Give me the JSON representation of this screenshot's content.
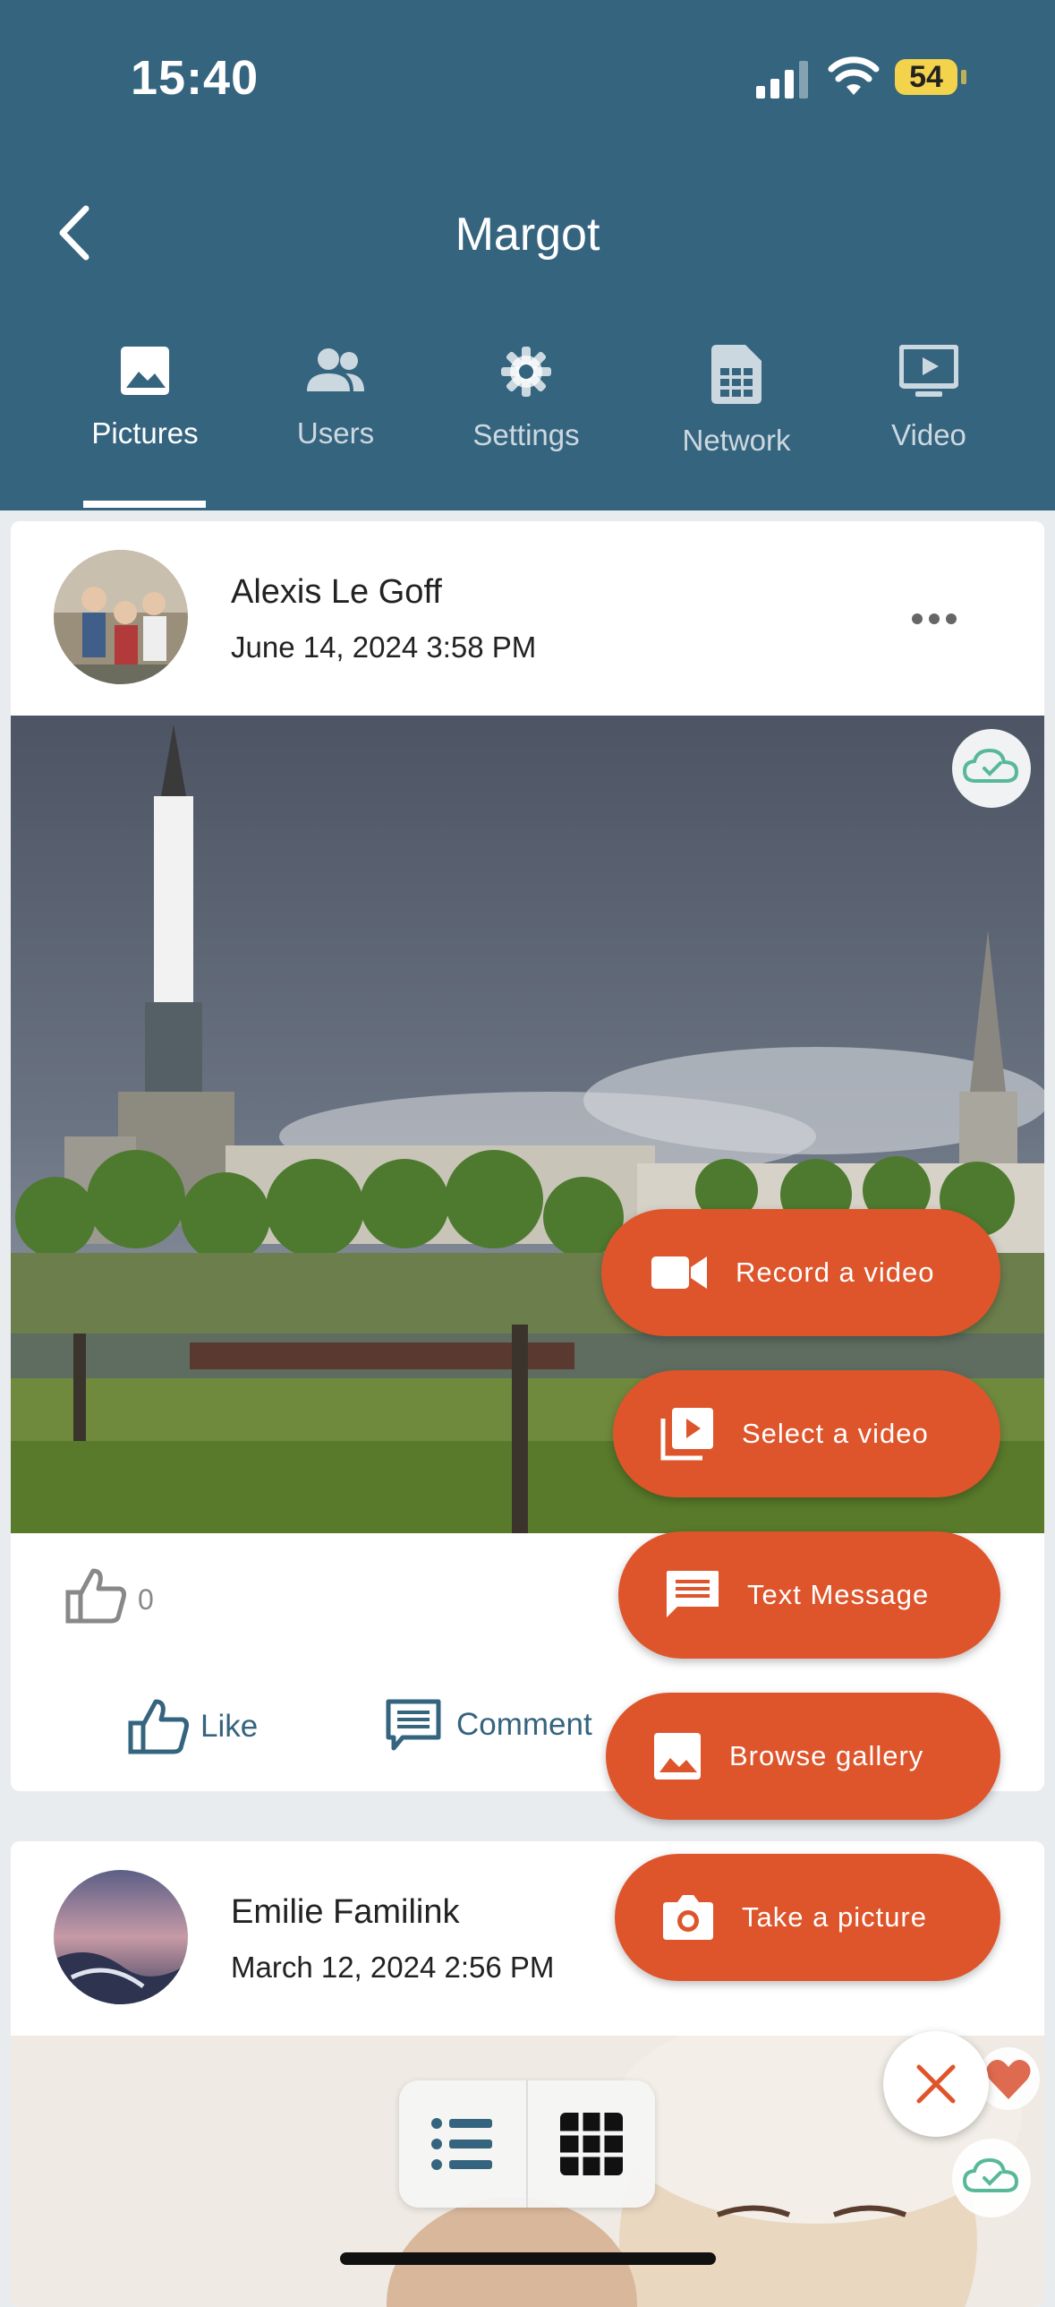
{
  "status": {
    "time": "15:40",
    "battery": "54"
  },
  "header": {
    "title": "Margot"
  },
  "tabs": [
    {
      "label": "Pictures",
      "icon": "image-icon",
      "active": true
    },
    {
      "label": "Users",
      "icon": "users-icon"
    },
    {
      "label": "Settings",
      "icon": "gear-icon"
    },
    {
      "label": "Network",
      "icon": "sim-card-icon"
    },
    {
      "label": "Video",
      "icon": "tv-play-icon"
    }
  ],
  "posts": [
    {
      "author": "Alexis Le Goff",
      "date": "June 14, 2024 3:58 PM",
      "likes": "0",
      "like_label": "Like",
      "comment_label": "Comment"
    },
    {
      "author": "Emilie Familink",
      "date": "March 12, 2024 2:56 PM"
    }
  ],
  "fab_menu": [
    {
      "label": "Record a video",
      "icon": "video-camera-icon"
    },
    {
      "label": "Select a video",
      "icon": "video-library-icon"
    },
    {
      "label": "Text Message",
      "icon": "message-icon"
    },
    {
      "label": "Browse gallery",
      "icon": "image-icon"
    },
    {
      "label": "Take a picture",
      "icon": "camera-icon"
    }
  ],
  "colors": {
    "header": "#35647f",
    "accent": "#de552c",
    "link": "#35647f"
  }
}
